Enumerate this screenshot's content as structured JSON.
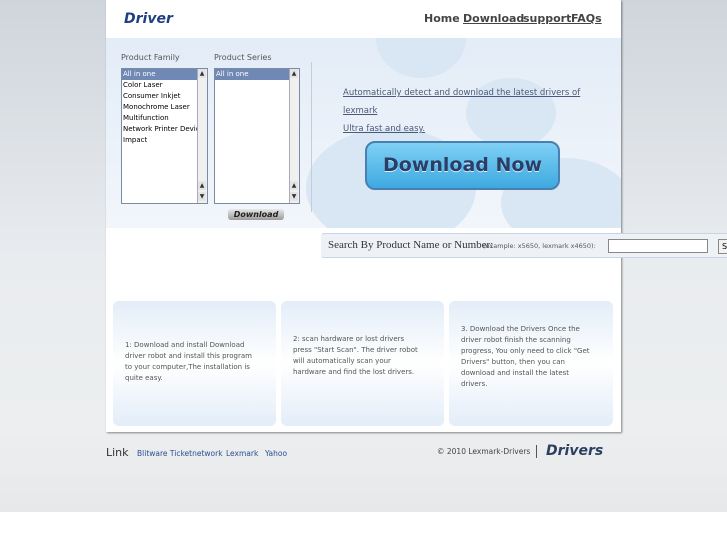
{
  "header": {
    "logo": "Driver",
    "nav": [
      "Home",
      "Download",
      "support",
      "FAQs"
    ]
  },
  "finder": {
    "family_label": "Product Family",
    "series_label": "Product Series",
    "family_options": [
      "All in one",
      "Color Laser",
      "Consumer Inkjet",
      "Monochrome Laser",
      "Multifunction",
      "Network Printer Device",
      "Impact"
    ],
    "series_options": [
      "All in one"
    ],
    "download_button": "Download"
  },
  "promo": {
    "line1": "Automatically detect and download the latest drivers of lexmark",
    "line2": "Ultra fast and easy.",
    "download_now": "Download Now"
  },
  "search": {
    "label": "Search By Product Name or Number:",
    "example": "(example: x5650, lexmark x4650):",
    "input_value": "",
    "button": "S"
  },
  "steps": [
    {
      "text": "1: Download and install Download driver robot and install this program to your computer,The installation is quite easy."
    },
    {
      "text": "2: scan hardware or lost drivers press \"Start Scan\". The driver robot will automatically scan your hardware and find the lost drivers."
    },
    {
      "text": "3. Download the Drivers Once the driver robot finish the scanning progress, You only need to click \"Get Drivers\" button, then you can download and install the latest drivers."
    }
  ],
  "footer": {
    "link_label": "Link",
    "links": [
      "Blitware Ticketnetwork",
      "Lexmark",
      "Yahoo"
    ],
    "copyright": "© 2010 Lexmark-Drivers",
    "logo": "Drivers"
  },
  "colors": {
    "accent": "#1f3f82",
    "button": "#3ea9e0"
  }
}
